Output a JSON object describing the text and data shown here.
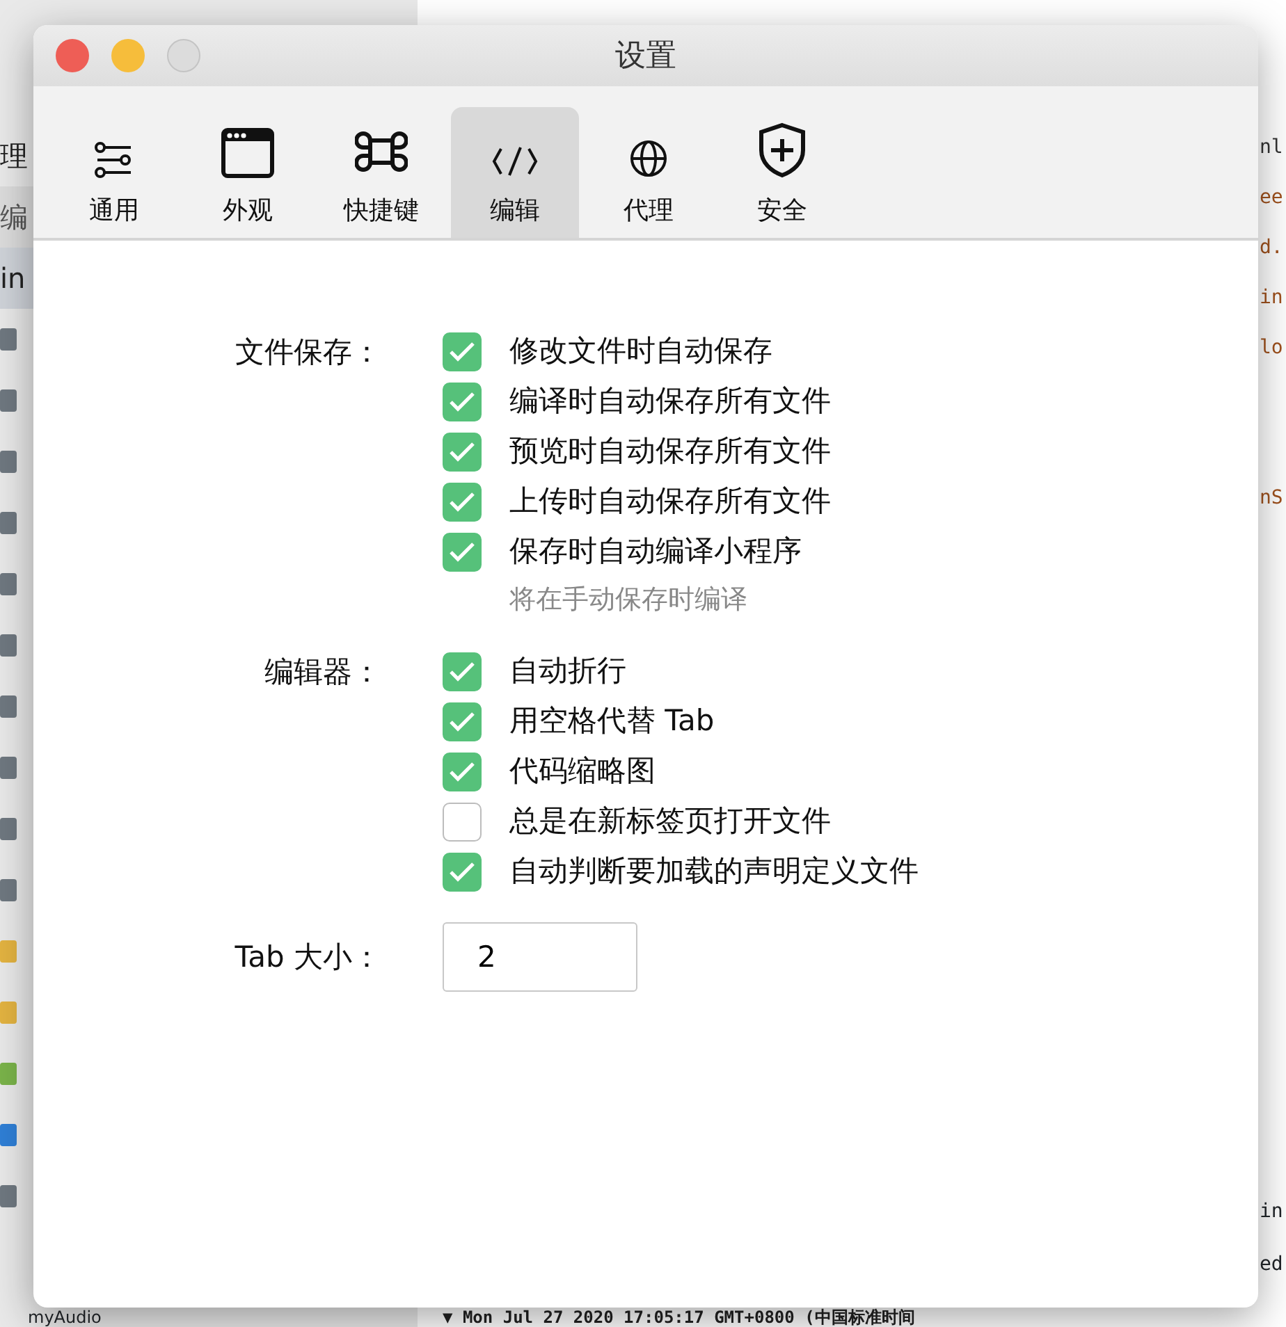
{
  "background": {
    "sidebar": [
      {
        "kind": "text",
        "text": "理"
      },
      {
        "kind": "header",
        "text": "编"
      },
      {
        "kind": "selected",
        "text": "in"
      },
      {
        "kind": "file"
      },
      {
        "kind": "file"
      },
      {
        "kind": "file"
      },
      {
        "kind": "file"
      },
      {
        "kind": "file"
      },
      {
        "kind": "file"
      },
      {
        "kind": "file"
      },
      {
        "kind": "file"
      },
      {
        "kind": "file"
      },
      {
        "kind": "folder"
      },
      {
        "kind": "js"
      },
      {
        "kind": "json"
      },
      {
        "kind": "html"
      },
      {
        "kind": "css"
      },
      {
        "kind": "file"
      }
    ],
    "sidebar_last": "myAudio",
    "code_lines": [
      {
        "text": "nl",
        "color": "#333333"
      },
      {
        "text": "ee",
        "color": "#a0521e"
      },
      {
        "text": "d.",
        "color": "#a0521e"
      },
      {
        "text": "in",
        "color": "#a0521e"
      },
      {
        "text": "lo",
        "color": "#a0521e"
      },
      {
        "text": "nS",
        "color": "#a0521e"
      }
    ],
    "console_lines": [
      "in",
      "ed"
    ],
    "log_line": "▼ Mon Jul 27 2020 17:05:17 GMT+0800 (中国标准时间"
  },
  "window": {
    "title": "设置"
  },
  "tabs": [
    {
      "label": "通用",
      "kind": "sliders",
      "selected": false
    },
    {
      "label": "外观",
      "kind": "window",
      "selected": false
    },
    {
      "label": "快捷键",
      "kind": "command",
      "selected": false
    },
    {
      "label": "编辑",
      "kind": "code",
      "selected": true
    },
    {
      "label": "代理",
      "kind": "globe",
      "selected": false
    },
    {
      "label": "安全",
      "kind": "shield",
      "selected": false
    }
  ],
  "sections": [
    {
      "label": "文件保存：",
      "options": [
        {
          "label": "修改文件时自动保存",
          "checked": true
        },
        {
          "label": "编译时自动保存所有文件",
          "checked": true
        },
        {
          "label": "预览时自动保存所有文件",
          "checked": true
        },
        {
          "label": "上传时自动保存所有文件",
          "checked": true
        },
        {
          "label": "保存时自动编译小程序",
          "checked": true,
          "hint": "将在手动保存时编译"
        }
      ]
    },
    {
      "label": "编辑器：",
      "options": [
        {
          "label": "自动折行",
          "checked": true
        },
        {
          "label": "用空格代替 Tab",
          "checked": true
        },
        {
          "label": "代码缩略图",
          "checked": true
        },
        {
          "label": "总是在新标签页打开文件",
          "checked": false
        },
        {
          "label": "自动判断要加载的声明定义文件",
          "checked": true
        }
      ]
    }
  ],
  "tab_size": {
    "label": "Tab 大小：",
    "value": "2"
  }
}
